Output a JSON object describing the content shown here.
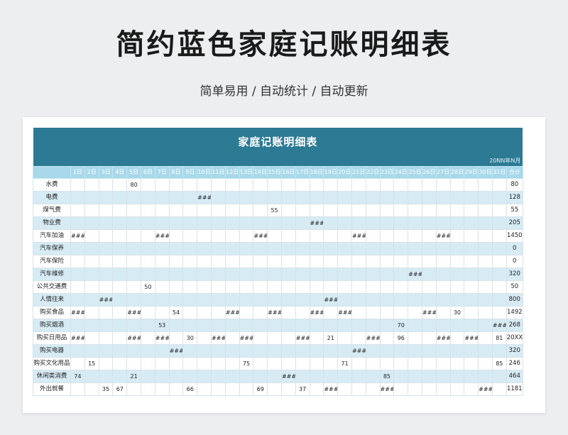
{
  "header": {
    "title": "简约蓝色家庭记账明细表",
    "subtitle": "简单易用 / 自动统计 / 自动更新"
  },
  "sheet": {
    "title": "家庭记账明细表",
    "date_label": "20NN年N月",
    "day_headers": [
      "1日",
      "2日",
      "3日",
      "4日",
      "5日",
      "6日",
      "7日",
      "8日",
      "9日",
      "10日",
      "11日",
      "12日",
      "13日",
      "14日",
      "15日",
      "16日",
      "17日",
      "18日",
      "19日",
      "20日",
      "21日",
      "22日",
      "23日",
      "24日",
      "25日",
      "26日",
      "27日",
      "28日",
      "29日",
      "30日",
      "31日"
    ],
    "total_header": "合计",
    "rows": [
      {
        "label": "水费",
        "cells": {
          "5": "80"
        },
        "total": "80"
      },
      {
        "label": "电费",
        "cells": {
          "10": "###"
        },
        "total": "128"
      },
      {
        "label": "煤气费",
        "cells": {
          "15": "55"
        },
        "total": "55"
      },
      {
        "label": "物业费",
        "cells": {
          "18": "###"
        },
        "total": "205"
      },
      {
        "label": "汽车加油",
        "cells": {
          "1": "###",
          "7": "###",
          "14": "###",
          "21": "###",
          "27": "###"
        },
        "total": "1450"
      },
      {
        "label": "汽车保养",
        "cells": {},
        "total": "0"
      },
      {
        "label": "汽车保险",
        "cells": {},
        "total": "0"
      },
      {
        "label": "汽车维修",
        "cells": {
          "25": "###"
        },
        "total": "320"
      },
      {
        "label": "公共交通费",
        "cells": {
          "6": "50"
        },
        "total": "50"
      },
      {
        "label": "人情往来",
        "cells": {
          "3": "###",
          "19": "###"
        },
        "total": "800"
      },
      {
        "label": "购买食品",
        "cells": {
          "1": "###",
          "5": "###",
          "8": "54",
          "12": "###",
          "15": "###",
          "18": "###",
          "20": "###",
          "26": "###",
          "28": "30"
        },
        "total": "1492"
      },
      {
        "label": "购买烟酒",
        "cells": {
          "7": "53",
          "24": "70",
          "31": "###"
        },
        "total": "268"
      },
      {
        "label": "购买日用品",
        "cells": {
          "1": "###",
          "5": "###",
          "7": "###",
          "9": "30",
          "11": "###",
          "13": "###",
          "17": "###",
          "19": "21",
          "22": "###",
          "24": "96",
          "27": "###",
          "29": "###",
          "31": "81"
        },
        "total": "20XX.0"
      },
      {
        "label": "购买电器",
        "cells": {
          "8": "###",
          "21": "###"
        },
        "total": "320"
      },
      {
        "label": "购买文化用品",
        "cells": {
          "2": "15",
          "13": "75",
          "20": "71",
          "31": "85"
        },
        "total": "246"
      },
      {
        "label": "休闲类消费",
        "cells": {
          "1": "74",
          "5": "21",
          "16": "###",
          "23": "85"
        },
        "total": "464"
      },
      {
        "label": "外出就餐",
        "cells": {
          "3": "35",
          "4": "67",
          "9": "66",
          "14": "69",
          "17": "37",
          "19": "###",
          "23": "###",
          "30": "###"
        },
        "total": "1181"
      }
    ]
  }
}
